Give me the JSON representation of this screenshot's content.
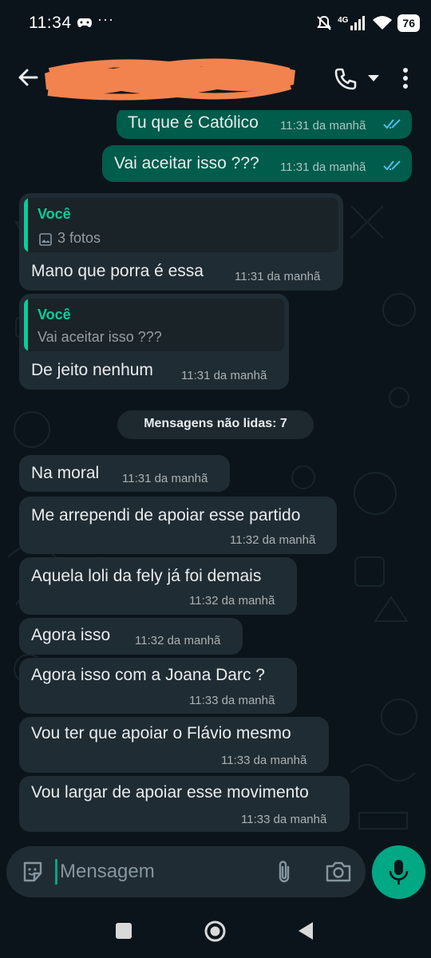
{
  "status_bar": {
    "time": "11:34",
    "dots": "···",
    "network": "4G",
    "battery": "76",
    "icons": [
      "game-controller-icon",
      "mute-icon",
      "signal-icon",
      "wifi-icon",
      "battery-icon"
    ]
  },
  "header": {
    "contact_name_redacted": true,
    "icons": [
      "back-arrow-icon",
      "phone-icon",
      "caret-down-icon",
      "more-vert-icon"
    ]
  },
  "messages": {
    "m1": {
      "text": "Tu que é Católico",
      "time": "11:31 da manhã",
      "direction": "outgoing",
      "read": true
    },
    "m2": {
      "text": "Vai aceitar isso ???",
      "time": "11:31 da manhã",
      "direction": "outgoing",
      "read": true
    },
    "m3": {
      "quote_author": "Você",
      "quote_text": "3 fotos",
      "text": "Mano que porra é essa",
      "time": "11:31 da manhã",
      "direction": "incoming"
    },
    "m4": {
      "quote_author": "Você",
      "quote_text": "Vai aceitar isso ???",
      "text": "De jeito nenhum",
      "time": "11:31 da manhã",
      "direction": "incoming"
    },
    "unread": "Mensagens não lidas: 7",
    "m5": {
      "text": "Na moral",
      "time": "11:31 da manhã",
      "direction": "incoming"
    },
    "m6": {
      "text": "Me arrependi de apoiar esse partido",
      "time": "11:32 da manhã",
      "direction": "incoming"
    },
    "m7": {
      "text": "Aquela loli da fely já foi demais",
      "time": "11:32 da manhã",
      "direction": "incoming"
    },
    "m8": {
      "text": "Agora isso",
      "time": "11:32 da manhã",
      "direction": "incoming"
    },
    "m9": {
      "text": "Agora isso com a Joana Darc ?",
      "time": "11:33 da manhã",
      "direction": "incoming"
    },
    "m10": {
      "text": "Vou ter que apoiar o Flávio mesmo",
      "time": "11:33 da manhã",
      "direction": "incoming"
    },
    "m11": {
      "text": "Vou largar de apoiar esse movimento",
      "time": "11:33 da manhã",
      "direction": "incoming"
    }
  },
  "composer": {
    "placeholder": "Mensagem",
    "icons": [
      "sticker-icon",
      "attach-icon",
      "camera-icon",
      "mic-icon"
    ]
  },
  "colors": {
    "background": "#0b141a",
    "outgoing_bubble": "#005c4b",
    "incoming_bubble": "#202c33",
    "accent": "#00a884",
    "quote_author": "#06cf9c",
    "read_ticks": "#53bdeb",
    "redaction": "#f2834f"
  }
}
